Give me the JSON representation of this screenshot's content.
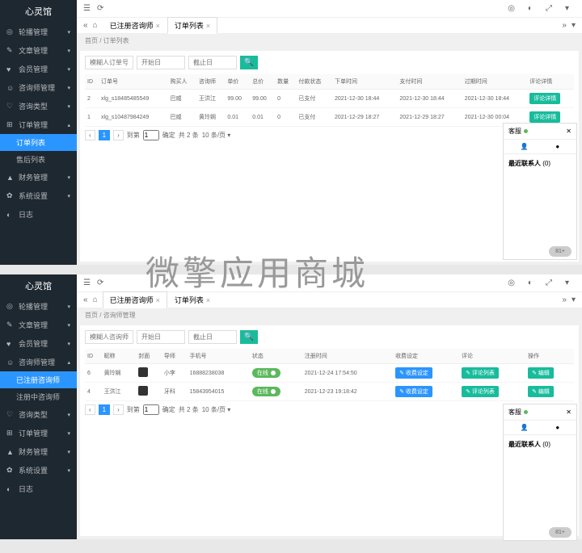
{
  "watermark": "微擎应用商城",
  "top": {
    "sidebar": {
      "title": "心灵馆",
      "items": [
        {
          "icon": "◎",
          "label": "轮播管理",
          "chev": "▾"
        },
        {
          "icon": "✎",
          "label": "文章管理",
          "chev": "▾"
        },
        {
          "icon": "♥",
          "label": "会员管理",
          "chev": "▾"
        },
        {
          "icon": "☺",
          "label": "咨询师管理",
          "chev": "▾"
        },
        {
          "icon": "♡",
          "label": "咨询类型",
          "chev": "▾"
        },
        {
          "icon": "⊞",
          "label": "订单管理",
          "chev": "▴",
          "sub": [
            {
              "label": "订单列表",
              "active": true
            },
            {
              "label": "售后列表"
            }
          ]
        },
        {
          "icon": "▲",
          "label": "财务管理",
          "chev": "▾"
        },
        {
          "icon": "✿",
          "label": "系统设置",
          "chev": "▾"
        },
        {
          "icon": "◐",
          "label": "日志"
        }
      ]
    },
    "tabs": [
      {
        "label": "已注册咨询师"
      },
      {
        "label": "订单列表",
        "active": true
      }
    ],
    "crumb": "首页 / 订单列表",
    "search": {
      "p1": "模糊人订单号",
      "p2": "开始日",
      "p3": "截止日"
    },
    "table": {
      "headers": [
        "ID",
        "订单号",
        "购买人",
        "咨询师",
        "单价",
        "总价",
        "数量",
        "付款状态",
        "下单时间",
        "支付时间",
        "过期时间",
        "评论详情"
      ],
      "rows": [
        {
          "id": "2",
          "no": "xlg_s18485485549",
          "buyer": "巴威",
          "con": "王洪江",
          "price": "99.00",
          "total": "99.00",
          "qty": "0",
          "status": "已支付",
          "t1": "2021-12-30 18:44",
          "t2": "2021-12-30 18:44",
          "t3": "2021-12-30 18:44",
          "btn": "评论详情"
        },
        {
          "id": "1",
          "no": "xlg_s10487984249",
          "buyer": "巴威",
          "con": "黄玲娴",
          "price": "0.01",
          "total": "0.01",
          "qty": "0",
          "status": "已支付",
          "t1": "2021-12-29 18:27",
          "t2": "2021-12-29 18:27",
          "t3": "2021-12-30 00:04",
          "btn": "评论详情"
        }
      ]
    },
    "pager": {
      "page": "1",
      "goto": "到第",
      "gopage": "1",
      "confirm": "确定",
      "total": "共 2 条",
      "per": "10 条/页 ▾"
    }
  },
  "bottom": {
    "sidebar": {
      "title": "心灵馆",
      "items": [
        {
          "icon": "◎",
          "label": "轮播管理",
          "chev": "▾"
        },
        {
          "icon": "✎",
          "label": "文章管理",
          "chev": "▾"
        },
        {
          "icon": "♥",
          "label": "会员管理",
          "chev": "▾"
        },
        {
          "icon": "☺",
          "label": "咨询师管理",
          "chev": "▴",
          "sub": [
            {
              "label": "已注册咨询师",
              "active": true
            },
            {
              "label": "注册中咨询师"
            }
          ]
        },
        {
          "icon": "♡",
          "label": "咨询类型",
          "chev": "▾"
        },
        {
          "icon": "⊞",
          "label": "订单管理",
          "chev": "▾"
        },
        {
          "icon": "▲",
          "label": "财务管理",
          "chev": "▾"
        },
        {
          "icon": "✿",
          "label": "系统设置",
          "chev": "▾"
        },
        {
          "icon": "◐",
          "label": "日志"
        }
      ]
    },
    "tabs": [
      {
        "label": "已注册咨询师",
        "active": true
      },
      {
        "label": "订单列表"
      }
    ],
    "crumb": "首页 / 咨询师管理",
    "search": {
      "p1": "模糊人咨询师姓名",
      "p2": "开始日",
      "p3": "截止日"
    },
    "table": {
      "headers": [
        "ID",
        "昵称",
        "封面",
        "导师",
        "手机号",
        "状态",
        "注册时间",
        "收费设定",
        "评论",
        "操作"
      ],
      "rows": [
        {
          "id": "6",
          "nick": "黄玲娴",
          "tutor": "小李",
          "phone": "16888238038",
          "st": "在线",
          "time": "2021-12-24 17:54:50",
          "b1": "✎ 收费设定",
          "b2": "✎ 评论列表",
          "b3": "✎ 编辑"
        },
        {
          "id": "4",
          "nick": "王洪江",
          "tutor": "牙科",
          "phone": "15843954015",
          "st": "在线",
          "time": "2021-12-23 19:18:42",
          "b1": "✎ 收费设定",
          "b2": "✎ 评论列表",
          "b3": "✎ 编辑"
        }
      ]
    },
    "pager": {
      "page": "1",
      "goto": "到第",
      "gopage": "1",
      "confirm": "确定",
      "total": "共 2 条",
      "per": "10 条/页 ▾"
    }
  },
  "chat": {
    "title": "客服",
    "recent": "最近联系人",
    "count": "(0)",
    "badge": "81+"
  }
}
